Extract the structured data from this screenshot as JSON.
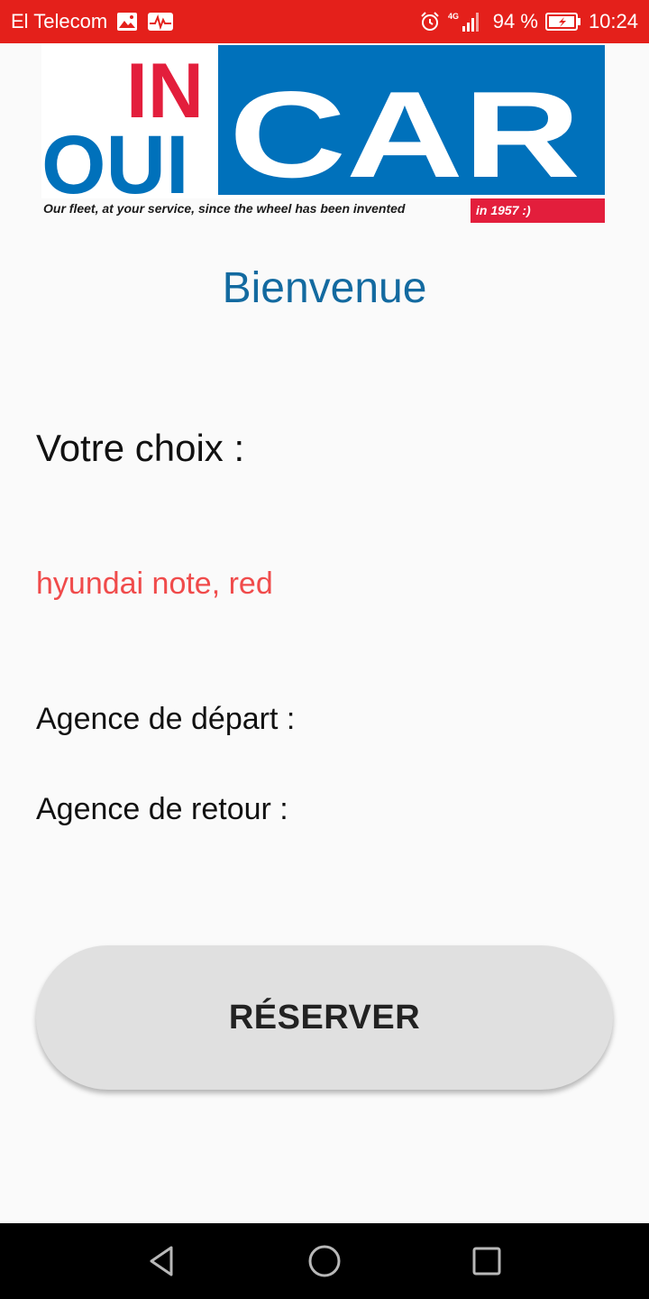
{
  "status_bar": {
    "carrier": "El Telecom",
    "network": "4G",
    "battery": "94 %",
    "time": "10:24",
    "icons": [
      "image-icon",
      "activity-icon",
      "alarm-icon",
      "signal-icon",
      "battery-charging-icon"
    ]
  },
  "logo": {
    "words": [
      "IN",
      "OUI",
      "CAR"
    ],
    "tagline": "Our fleet, at your service, since the wheel has been invented",
    "tagline_highlight": "in 1957 :)"
  },
  "main": {
    "welcome": "Bienvenue",
    "choice_label": "Votre choix :",
    "choice_value": "hyundai note, red",
    "agency_depart": "Agence de départ :",
    "agency_return": "Agence de retour :",
    "reserve_label": "RÉSERVER"
  },
  "nav_bar": {
    "icons": [
      "back-icon",
      "home-icon",
      "recents-icon"
    ]
  },
  "colors": {
    "status_bar": "#e4201b",
    "logo_blue": "#0071bb",
    "logo_red": "#e31e3c",
    "welcome_text": "#136aa0",
    "choice_value_text": "#f04b4b",
    "button_bg": "#e0e0e0"
  }
}
